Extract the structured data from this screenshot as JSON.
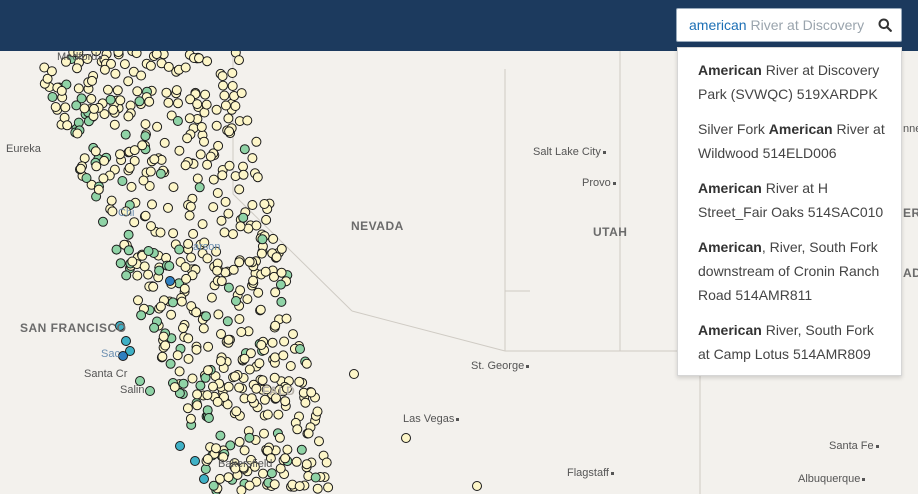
{
  "search": {
    "typed": "american",
    "ghost": " River at Discovery",
    "value": "american River at Discovery"
  },
  "suggestions": [
    {
      "pre": "",
      "match": "American",
      "post": " River at Discovery Park (SVWQC) 519XARDPK"
    },
    {
      "pre": "Silver Fork ",
      "match": "American",
      "post": " River at Wildwood 514ELD006"
    },
    {
      "pre": "",
      "match": "American",
      "post": " River at H Street_Fair Oaks 514SAC010"
    },
    {
      "pre": "",
      "match": "American",
      "post": ", River, South Fork downstream of Cronin Ranch Road 514AMR811"
    },
    {
      "pre": "",
      "match": "American",
      "post": " River, South Fork at Camp Lotus 514AMR809"
    }
  ],
  "map_labels": {
    "medford": "Medford",
    "eureka": "Eureka",
    "salt_lake_city": "Salt Lake City",
    "provo": "Provo",
    "nevada": "NEVADA",
    "utah": "UTAH",
    "san_francisco": "SAN FRANCISCO",
    "santa_cruz": "Santa Cr",
    "salinas": "Salin",
    "st_george": "St. George",
    "las_vegas": "Las Vegas",
    "bakersfield": "Bakersfield",
    "flagstaff": "Flagstaff",
    "santa_fe": "Santa Fe",
    "albuquerque": "Albuquerque",
    "carson": "arson",
    "chico": "Chi",
    "sacramento": "Sac",
    "fresno": "FALD",
    "edge_colorado": "ER",
    "edge_nne": "nne",
    "edge_ado": "ADO"
  },
  "colors": {
    "header": "#1c3a5e",
    "marker_default": "#fdf6c8",
    "marker_green": "#8fd3a6",
    "marker_teal": "#3fb1c6",
    "marker_blue": "#2f7fc1",
    "accent": "#1c6fb5"
  },
  "icons": {
    "search": "search-icon"
  }
}
